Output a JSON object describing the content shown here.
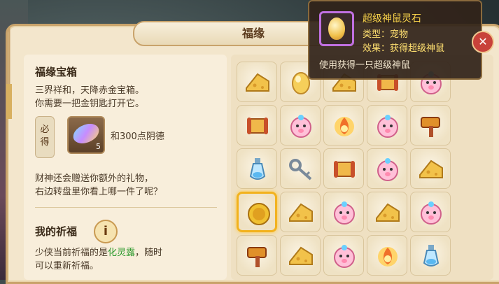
{
  "window": {
    "title": "福缘"
  },
  "left": {
    "box_title": "福缘宝箱",
    "intro_line1": "三界祥和，天降赤金宝箱。",
    "intro_line2": "你需要一把金钥匙打开它。",
    "must_label_1": "必",
    "must_label_2": "得",
    "item_count": "5",
    "reward_text": "和300点阴德",
    "gift_line1": "财神还会赠送你额外的礼物，",
    "gift_line2": "右边转盘里你看上哪一件了呢？",
    "blessing_title": "我的祈福",
    "info_glyph": "i",
    "blessing_prefix": "少侠当前祈福的是",
    "blessing_item": "化灵露",
    "blessing_suffix": "，随时",
    "blessing_line2": "可以重新祈福。"
  },
  "tooltip": {
    "name": "超级神鼠灵石",
    "type": "类型：宠物",
    "effect": "效果：获得超级神鼠",
    "description": "使用获得一只超级神鼠"
  },
  "close_glyph": "✕",
  "grid": {
    "items": [
      [
        "cheese",
        "egg",
        "cheese",
        "scroll",
        "pig"
      ],
      [
        "scroll",
        "pig",
        "fire",
        "pig",
        "hammer"
      ],
      [
        "bottle",
        "key",
        "scroll",
        "pig",
        "cheese"
      ],
      [
        "coin",
        "cheese",
        "pig",
        "cheese",
        "pig"
      ],
      [
        "hammer",
        "cheese",
        "pig",
        "fire",
        "bottle"
      ]
    ],
    "selected_row": 3,
    "selected_col": 0
  },
  "colors": {
    "panel": "#f3e6cc",
    "border": "#c9a36b",
    "highlight": "#f2b21e",
    "tooltip_title": "#f8d24a",
    "blessing_item": "#2e9a2e"
  }
}
